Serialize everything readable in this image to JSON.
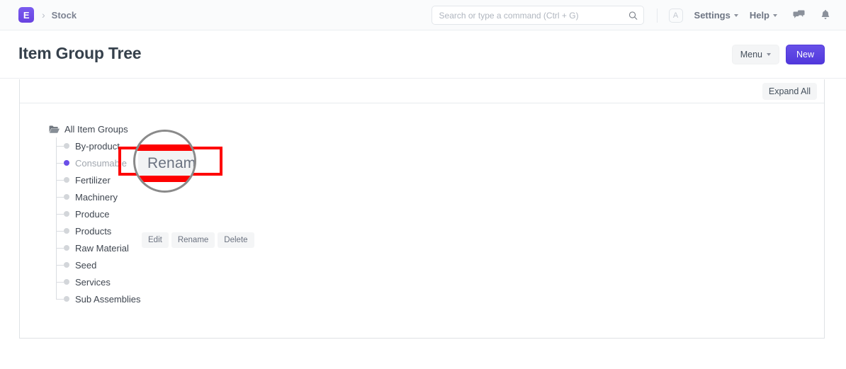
{
  "navbar": {
    "logo_letter": "E",
    "breadcrumb_separator": "›",
    "breadcrumb": "Stock",
    "search": {
      "value": "",
      "placeholder": "Search or type a command (Ctrl + G)"
    },
    "avatar_letter": "A",
    "settings_label": "Settings",
    "help_label": "Help",
    "icons": [
      "search-icon",
      "chat-icon",
      "bell-icon"
    ]
  },
  "page": {
    "title": "Item Group Tree",
    "menu_button": "Menu",
    "new_button": "New"
  },
  "toolbar": {
    "expand_all": "Expand All"
  },
  "tree": {
    "root": {
      "label": "All Item Groups",
      "icon": "open-folder-icon"
    },
    "nodes": [
      {
        "label": "By-product",
        "active": false
      },
      {
        "label": "Consumable",
        "active": true
      },
      {
        "label": "Fertilizer",
        "active": false
      },
      {
        "label": "Machinery",
        "active": false
      },
      {
        "label": "Produce",
        "active": false
      },
      {
        "label": "Products",
        "active": false
      },
      {
        "label": "Raw Material",
        "active": false
      },
      {
        "label": "Seed",
        "active": false
      },
      {
        "label": "Services",
        "active": false
      },
      {
        "label": "Sub Assemblies",
        "active": false
      }
    ]
  },
  "node_actions": {
    "edit": "Edit",
    "rename": "Rename",
    "delete": "Delete"
  },
  "annotation": {
    "highlight_color": "#fe0000",
    "magnified_text": "Rename",
    "circle_border_color": "#8a8a8a"
  },
  "colors": {
    "brand_purple": "#5a46e0",
    "active_dot": "#6a4fe8",
    "navbar_bg": "#fafbfc",
    "text_dark": "#36414c",
    "text_muted": "#7c8291"
  }
}
